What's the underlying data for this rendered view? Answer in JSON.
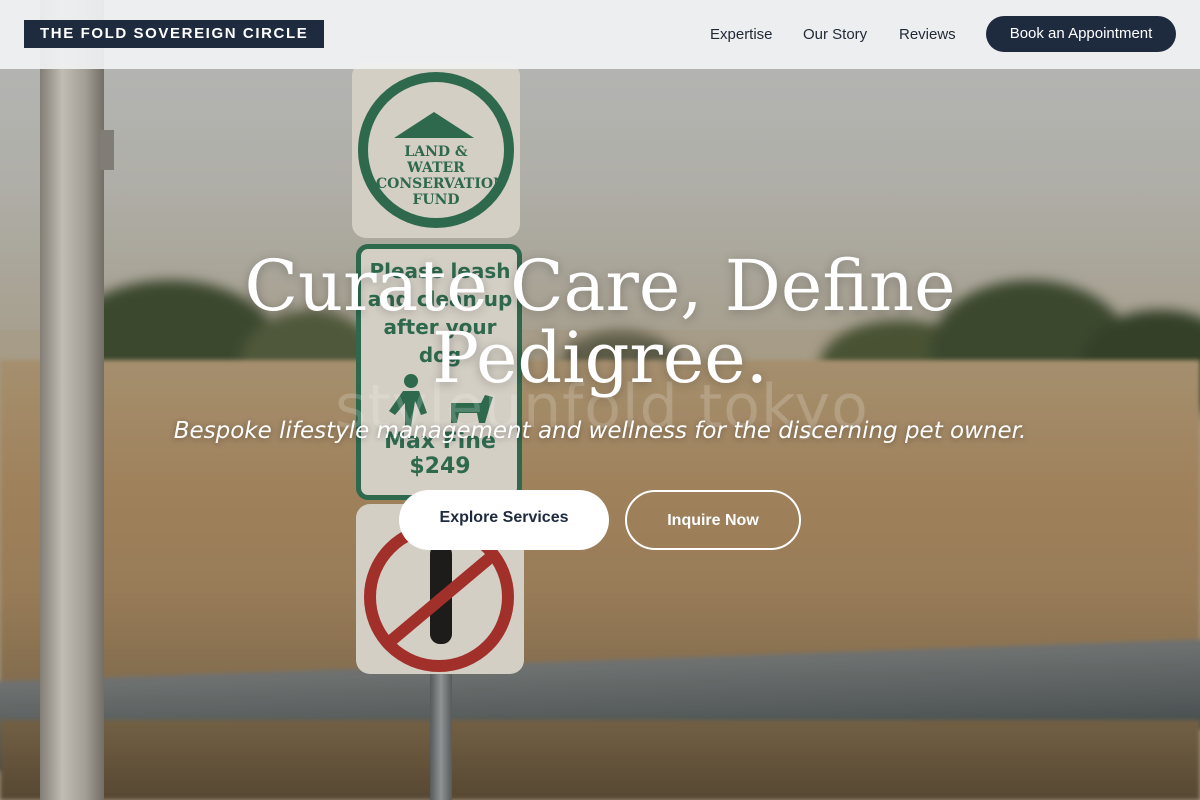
{
  "header": {
    "brand": "THE FOLD SOVEREIGN CIRCLE",
    "nav": [
      {
        "label": "Expertise"
      },
      {
        "label": "Our Story"
      },
      {
        "label": "Reviews"
      }
    ],
    "cta_label": "Book an Appointment"
  },
  "hero": {
    "title": "Curate Care, Define Pedigree.",
    "subtitle": "Bespoke lifestyle management and wellness for the discerning pet owner.",
    "primary_button": "Explore Services",
    "secondary_button": "Inquire Now",
    "watermark": "styleunfold tokyo"
  },
  "background_photo": {
    "sign_top_text": "LAND & WATER CONSERVATION FUND",
    "sign_middle_text": "Please leash and clean up after your dog",
    "sign_middle_fine": "Max Fine $249"
  },
  "colors": {
    "brand_navy": "#1e2a3e",
    "header_bg": "#f0f2f3",
    "sign_green": "#2f7357",
    "sign_red": "#b3332e"
  }
}
